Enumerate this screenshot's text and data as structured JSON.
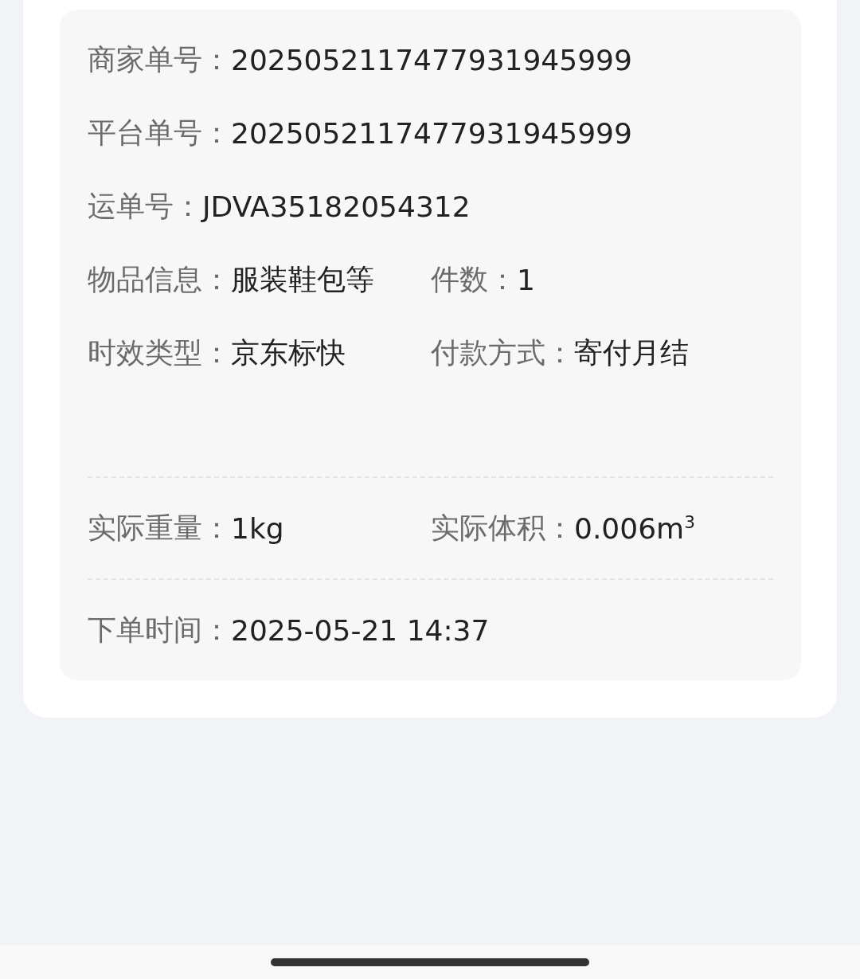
{
  "sections": [
    {
      "rows": [
        {
          "fields": [
            {
              "kind": "text",
              "label": "商家单号：",
              "value": "2025052117477931945999"
            }
          ]
        },
        {
          "fields": [
            {
              "kind": "text",
              "label": "平台单号：",
              "value": "2025052117477931945999"
            }
          ]
        },
        {
          "fields": [
            {
              "kind": "copy",
              "label": "运单号：",
              "value": "JDVA35182054312"
            }
          ]
        },
        {
          "fields": [
            {
              "kind": "text",
              "label": "物品信息：",
              "value": "服装鞋包等"
            },
            {
              "kind": "text",
              "label": "件数：",
              "value": "1"
            }
          ]
        },
        {
          "fields": [
            {
              "kind": "text",
              "label": "时效类型：",
              "value": "京东标快"
            },
            {
              "kind": "text",
              "label": "付款方式：",
              "value": "寄付月结"
            }
          ]
        }
      ]
    },
    {
      "rows": [
        {
          "fields": [
            {
              "kind": "text",
              "label": "实际重量：",
              "value": "1kg"
            },
            {
              "kind": "text",
              "label": "实际体积：",
              "value": "0.006m$^{3}$"
            }
          ]
        }
      ]
    },
    {
      "rows": [
        {
          "fields": [
            {
              "kind": "text",
              "label": "下单时间：",
              "value": "2025-05-21 14:37"
            }
          ]
        }
      ]
    }
  ]
}
